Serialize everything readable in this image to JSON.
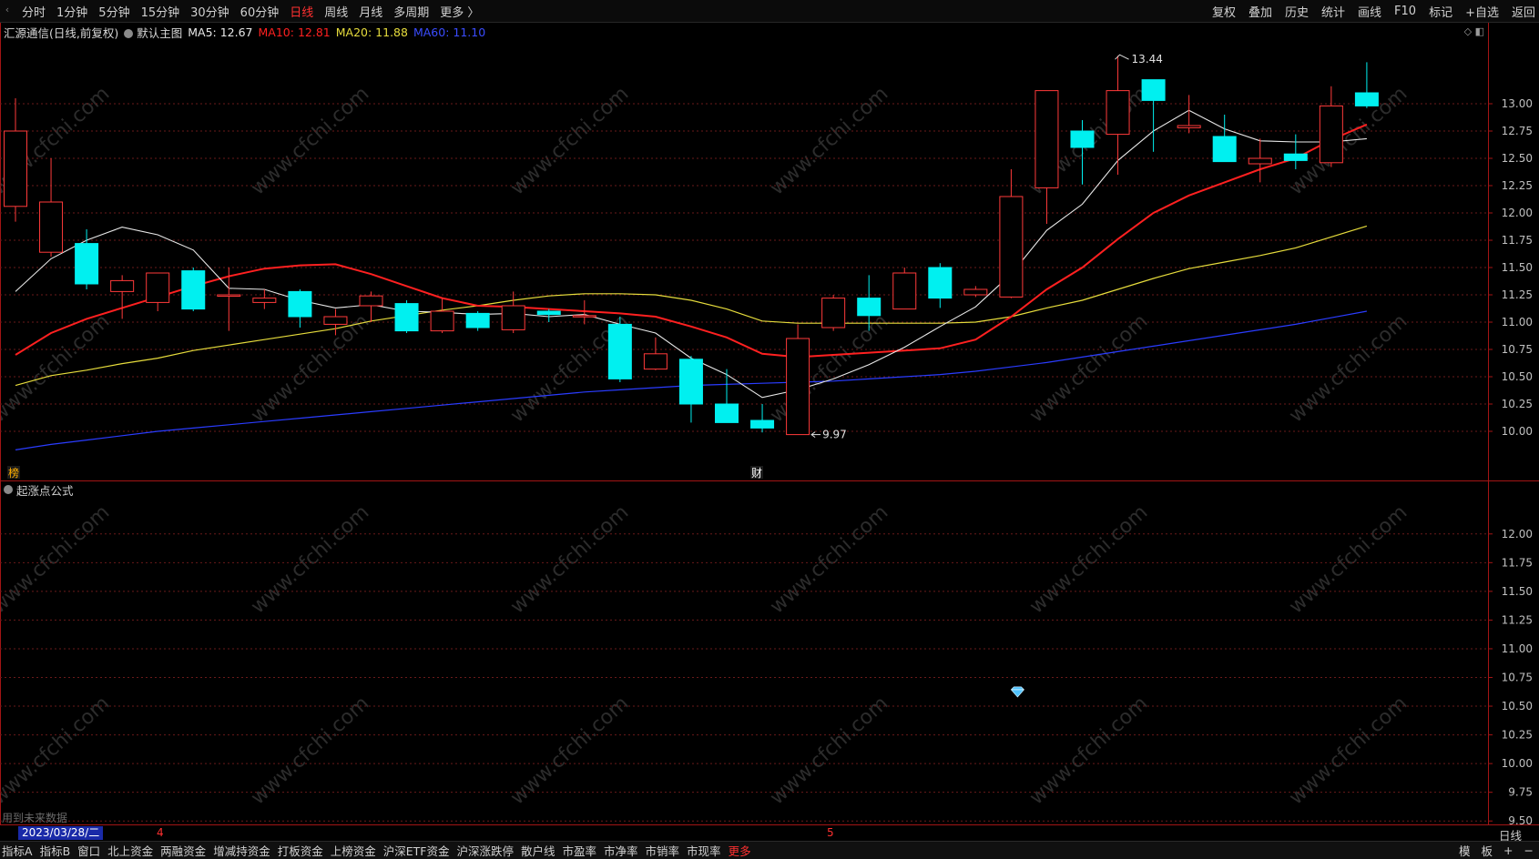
{
  "topbar": {
    "periods": [
      "分时",
      "1分钟",
      "5分钟",
      "15分钟",
      "30分钟",
      "60分钟",
      "日线",
      "周线",
      "月线",
      "多周期",
      "更多 〉"
    ],
    "active_period": "日线",
    "tools": [
      "复权",
      "叠加",
      "历史",
      "统计",
      "画线",
      "F10",
      "标记",
      "+自选",
      "返回"
    ]
  },
  "info": {
    "stock": "汇源通信(日线,前复权)",
    "main_chart": "默认主图",
    "ma5": "MA5: 12.67",
    "ma10": "MA10: 12.81",
    "ma20": "MA20: 11.88",
    "ma60": "MA60: 11.10"
  },
  "indicator": {
    "name": "起涨点公式"
  },
  "markers": {
    "bang": "榜",
    "cai": "财",
    "high": "13.44",
    "low": "9.97"
  },
  "future_note": "用到未来数据",
  "bottom": {
    "date": "2023/03/28/二",
    "month4": "4",
    "month5": "5",
    "period": "日线",
    "tabs": [
      "指标A",
      "指标B",
      "窗口",
      "北上资金",
      "两融资金",
      "增减持资金",
      "打板资金",
      "上榜资金",
      "沪深ETF资金",
      "沪深涨跌停",
      "散户线",
      "市盈率",
      "市净率",
      "市销率",
      "市现率"
    ],
    "more": "更多",
    "right_tabs": [
      "模",
      "板",
      "+",
      "−"
    ]
  },
  "watermark": "www.cfchi.com",
  "colors": {
    "up": "#ff3a3a",
    "down": "#00f0f0",
    "ma5": "#e8e8e8",
    "ma10": "#ff2020",
    "ma20": "#e6dc3c",
    "ma60": "#2a3cff",
    "grid": "#6a1a1a",
    "axis": "#c0c0c0"
  },
  "chart_data": [
    {
      "type": "candlestick",
      "ylim": [
        9.55,
        13.55
      ],
      "yticks": [
        "10.00",
        "10.25",
        "10.50",
        "10.75",
        "11.00",
        "11.25",
        "11.50",
        "11.75",
        "12.00",
        "12.25",
        "12.50",
        "12.75",
        "13.00"
      ],
      "candles": [
        {
          "o": 12.06,
          "h": 13.05,
          "l": 11.92,
          "c": 12.75
        },
        {
          "o": 11.64,
          "h": 12.5,
          "l": 11.6,
          "c": 12.1
        },
        {
          "o": 11.72,
          "h": 11.85,
          "l": 11.3,
          "c": 11.35
        },
        {
          "o": 11.28,
          "h": 11.43,
          "l": 11.03,
          "c": 11.38
        },
        {
          "o": 11.18,
          "h": 11.45,
          "l": 11.1,
          "c": 11.45
        },
        {
          "o": 11.47,
          "h": 11.5,
          "l": 11.1,
          "c": 11.12
        },
        {
          "o": 11.25,
          "h": 11.5,
          "l": 10.92,
          "c": 11.25
        },
        {
          "o": 11.18,
          "h": 11.3,
          "l": 11.12,
          "c": 11.22
        },
        {
          "o": 11.28,
          "h": 11.3,
          "l": 10.95,
          "c": 11.05
        },
        {
          "o": 10.98,
          "h": 11.12,
          "l": 10.88,
          "c": 11.05
        },
        {
          "o": 11.15,
          "h": 11.28,
          "l": 11.0,
          "c": 11.24
        },
        {
          "o": 11.17,
          "h": 11.2,
          "l": 10.9,
          "c": 10.92
        },
        {
          "o": 10.92,
          "h": 11.22,
          "l": 10.9,
          "c": 11.1
        },
        {
          "o": 11.08,
          "h": 11.1,
          "l": 10.92,
          "c": 10.95
        },
        {
          "o": 10.93,
          "h": 11.28,
          "l": 10.9,
          "c": 11.15
        },
        {
          "o": 11.1,
          "h": 11.12,
          "l": 11.0,
          "c": 11.07
        },
        {
          "o": 11.06,
          "h": 11.2,
          "l": 10.98,
          "c": 11.06
        },
        {
          "o": 10.98,
          "h": 11.05,
          "l": 10.45,
          "c": 10.48
        },
        {
          "o": 10.57,
          "h": 10.86,
          "l": 10.56,
          "c": 10.71
        },
        {
          "o": 10.66,
          "h": 10.69,
          "l": 10.08,
          "c": 10.25
        },
        {
          "o": 10.25,
          "h": 10.57,
          "l": 10.08,
          "c": 10.08
        },
        {
          "o": 10.1,
          "h": 10.25,
          "l": 9.99,
          "c": 10.03
        },
        {
          "o": 9.97,
          "h": 10.98,
          "l": 9.97,
          "c": 10.85
        },
        {
          "o": 10.95,
          "h": 11.25,
          "l": 10.92,
          "c": 11.22
        },
        {
          "o": 11.22,
          "h": 11.43,
          "l": 10.92,
          "c": 11.06
        },
        {
          "o": 11.12,
          "h": 11.5,
          "l": 11.12,
          "c": 11.45
        },
        {
          "o": 11.5,
          "h": 11.54,
          "l": 11.13,
          "c": 11.22
        },
        {
          "o": 11.25,
          "h": 11.33,
          "l": 11.23,
          "c": 11.3
        },
        {
          "o": 11.23,
          "h": 12.4,
          "l": 11.22,
          "c": 12.15
        },
        {
          "o": 12.23,
          "h": 13.12,
          "l": 11.9,
          "c": 13.12
        },
        {
          "o": 12.75,
          "h": 12.85,
          "l": 12.26,
          "c": 12.6
        },
        {
          "o": 12.72,
          "h": 13.44,
          "l": 12.35,
          "c": 13.12
        },
        {
          "o": 13.22,
          "h": 13.22,
          "l": 12.56,
          "c": 13.03
        },
        {
          "o": 12.78,
          "h": 13.08,
          "l": 12.73,
          "c": 12.8
        },
        {
          "o": 12.7,
          "h": 12.9,
          "l": 12.47,
          "c": 12.47
        },
        {
          "o": 12.45,
          "h": 12.68,
          "l": 12.28,
          "c": 12.5
        },
        {
          "o": 12.54,
          "h": 12.72,
          "l": 12.4,
          "c": 12.48
        },
        {
          "o": 12.46,
          "h": 13.16,
          "l": 12.42,
          "c": 12.98
        },
        {
          "o": 13.1,
          "h": 13.38,
          "l": 12.96,
          "c": 12.98
        }
      ],
      "ma5": [
        11.28,
        11.58,
        11.75,
        11.87,
        11.8,
        11.66,
        11.31,
        11.3,
        11.2,
        11.13,
        11.16,
        11.1,
        11.09,
        11.07,
        11.08,
        11.05,
        11.07,
        10.98,
        10.9,
        10.67,
        10.52,
        10.31,
        10.38,
        10.48,
        10.61,
        10.77,
        10.96,
        11.14,
        11.44,
        11.84,
        12.08,
        12.48,
        12.75,
        12.94,
        12.77,
        12.66,
        12.65,
        12.65,
        12.68
      ],
      "ma10": [
        10.7,
        10.9,
        11.03,
        11.13,
        11.23,
        11.33,
        11.42,
        11.49,
        11.52,
        11.53,
        11.44,
        11.33,
        11.22,
        11.15,
        11.14,
        11.12,
        11.1,
        11.08,
        11.05,
        10.96,
        10.86,
        10.71,
        10.68,
        10.7,
        10.72,
        10.74,
        10.76,
        10.84,
        11.05,
        11.3,
        11.5,
        11.76,
        12.0,
        12.16,
        12.28,
        12.4,
        12.5,
        12.67,
        12.81
      ],
      "ma20": [
        10.42,
        10.51,
        10.56,
        10.62,
        10.67,
        10.74,
        10.79,
        10.84,
        10.89,
        10.94,
        11.01,
        11.06,
        11.11,
        11.15,
        11.2,
        11.24,
        11.26,
        11.26,
        11.25,
        11.2,
        11.12,
        11.01,
        10.99,
        10.99,
        10.99,
        10.99,
        10.99,
        11.0,
        11.05,
        11.13,
        11.2,
        11.3,
        11.4,
        11.49,
        11.55,
        11.61,
        11.68,
        11.78,
        11.88
      ],
      "ma60": [
        9.83,
        9.88,
        9.92,
        9.96,
        10.0,
        10.03,
        10.06,
        10.09,
        10.12,
        10.15,
        10.18,
        10.21,
        10.24,
        10.27,
        10.3,
        10.33,
        10.36,
        10.38,
        10.4,
        10.42,
        10.43,
        10.44,
        10.45,
        10.46,
        10.48,
        10.5,
        10.52,
        10.55,
        10.59,
        10.63,
        10.68,
        10.73,
        10.78,
        10.83,
        10.88,
        10.93,
        10.98,
        11.04,
        11.1
      ]
    },
    {
      "type": "scatter",
      "name": "起涨点公式",
      "ylim": [
        9.47,
        12.45
      ],
      "yticks": [
        "9.50",
        "9.75",
        "10.00",
        "10.25",
        "10.50",
        "10.75",
        "11.00",
        "11.25",
        "11.50",
        "11.75",
        "12.00"
      ],
      "signals": [
        {
          "index": 28,
          "value": 10.62
        }
      ]
    }
  ]
}
